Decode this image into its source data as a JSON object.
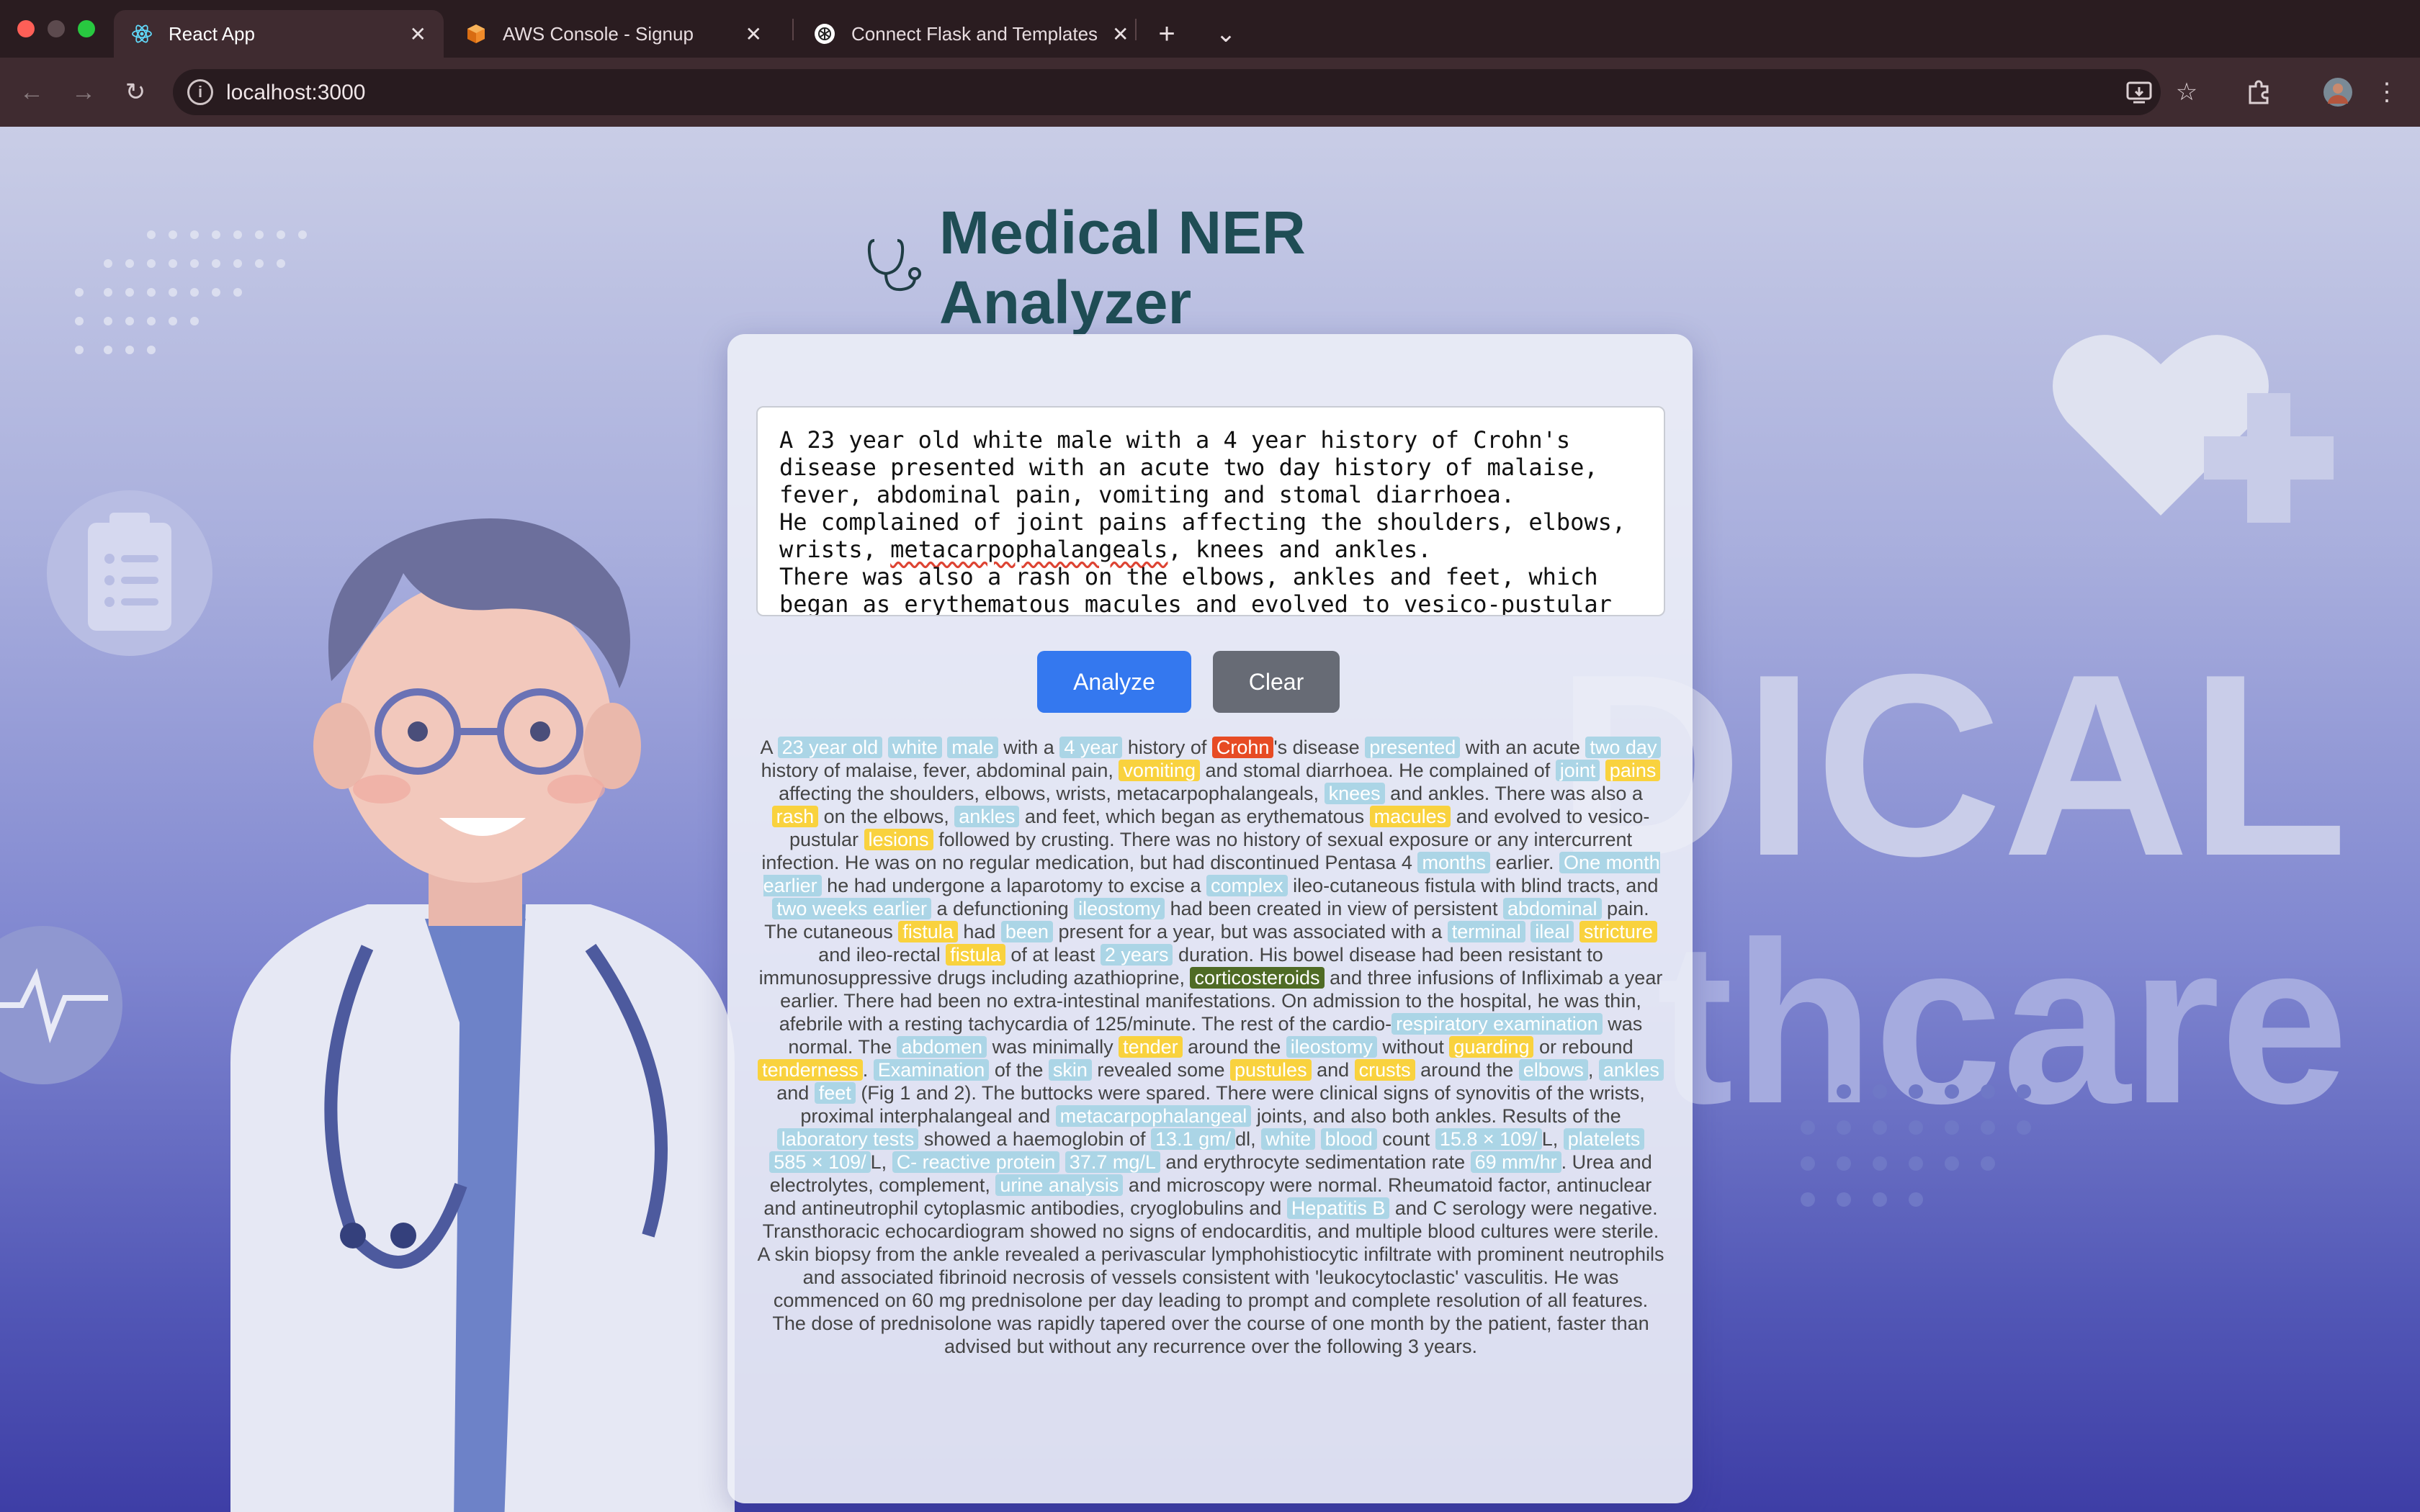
{
  "tabs": [
    {
      "label": "React App",
      "close": "✕"
    },
    {
      "label": "AWS Console - Signup",
      "close": "✕"
    },
    {
      "label": "Connect Flask and Templates",
      "close": "✕"
    }
  ],
  "new_tab_label": "+",
  "tab_list_label": "⌄",
  "address": "localhost:3000",
  "app": {
    "title": "Medical NER Analyzer",
    "textarea_text": "A 23 year old white male with a 4 year history of Crohn's disease presented with an acute two day history of malaise, fever, abdominal pain, vomiting and stomal diarrhoea.\nHe complained of joint pains affecting the shoulders, elbows, wrists, metacarpophalangeals, knees and ankles.\nThere was also a rash on the elbows, ankles and feet, which began as erythematous macules and evolved to vesico-pustular",
    "analyze_label": "Analyze",
    "clear_label": "Clear",
    "background_words": [
      "DICAL",
      "thcare"
    ],
    "entity_colors": {
      "b": "#abd5e6",
      "y": "#f9d23e",
      "r": "#e74b24",
      "g": "#4f6b25"
    },
    "result": [
      [
        "A ",
        ""
      ],
      [
        "23 year old",
        "b"
      ],
      [
        " ",
        ""
      ],
      [
        "white",
        "b"
      ],
      [
        " ",
        ""
      ],
      [
        "male",
        "b"
      ],
      [
        " with a ",
        ""
      ],
      [
        "4 year",
        "b"
      ],
      [
        " history of ",
        ""
      ],
      [
        "Crohn",
        "r"
      ],
      [
        "'s disease ",
        ""
      ],
      [
        "presented",
        "b"
      ],
      [
        " with an acute ",
        ""
      ],
      [
        "two day",
        "b"
      ],
      [
        " history of malaise, fever, abdominal pain, ",
        ""
      ],
      [
        "vomiting",
        "y"
      ],
      [
        " and stomal diarrhoea. He complained of ",
        ""
      ],
      [
        "joint",
        "b"
      ],
      [
        " ",
        ""
      ],
      [
        "pains",
        "y"
      ],
      [
        " affecting the shoulders, elbows, wrists, metacarpophalangeals, ",
        ""
      ],
      [
        "knees",
        "b"
      ],
      [
        " and ankles. There was also a ",
        ""
      ],
      [
        "rash",
        "y"
      ],
      [
        " on the elbows, ",
        ""
      ],
      [
        "ankles",
        "b"
      ],
      [
        " and feet, which began as erythematous ",
        ""
      ],
      [
        "macules",
        "y"
      ],
      [
        " and evolved to vesico-pustular ",
        ""
      ],
      [
        "lesions",
        "y"
      ],
      [
        " followed by crusting. There was no history of sexual exposure or any intercurrent infection. He was on no regular medication, but had discontinued Pentasa 4 ",
        ""
      ],
      [
        "months",
        "b"
      ],
      [
        " earlier. ",
        ""
      ],
      [
        "One month earlier",
        "b"
      ],
      [
        " he had undergone a laparotomy to excise a ",
        ""
      ],
      [
        "complex",
        "b"
      ],
      [
        " ileo-cutaneous fistula with blind tracts, and ",
        ""
      ],
      [
        "two weeks earlier",
        "b"
      ],
      [
        " a defunctioning ",
        ""
      ],
      [
        "ileostomy",
        "b"
      ],
      [
        " had been created in view of persistent ",
        ""
      ],
      [
        "abdominal",
        "b"
      ],
      [
        " pain. The cutaneous ",
        ""
      ],
      [
        "fistula",
        "y"
      ],
      [
        " had ",
        ""
      ],
      [
        "been",
        "b"
      ],
      [
        " present for a year, but was associated with a ",
        ""
      ],
      [
        "terminal",
        "b"
      ],
      [
        " ",
        ""
      ],
      [
        "ileal",
        "b"
      ],
      [
        " ",
        ""
      ],
      [
        "stricture",
        "y"
      ],
      [
        " and ileo-rectal ",
        ""
      ],
      [
        "fistula",
        "y"
      ],
      [
        " of at least ",
        ""
      ],
      [
        "2 years",
        "b"
      ],
      [
        " duration. His bowel disease had been resistant to immunosuppressive drugs including azathioprine, ",
        ""
      ],
      [
        "corticosteroids",
        "g"
      ],
      [
        " and three infusions of Infliximab a year earlier. There had been no extra-intestinal manifestations. On admission to the hospital, he was thin, afebrile with a resting tachycardia of 125/minute. The rest of the cardio-",
        ""
      ],
      [
        "respiratory examination",
        "b"
      ],
      [
        " was normal. The ",
        ""
      ],
      [
        "abdomen",
        "b"
      ],
      [
        " was minimally ",
        ""
      ],
      [
        "tender",
        "y"
      ],
      [
        " around the ",
        ""
      ],
      [
        "ileostomy",
        "b"
      ],
      [
        " without ",
        ""
      ],
      [
        "guarding",
        "y"
      ],
      [
        " or rebound ",
        ""
      ],
      [
        "tenderness",
        "y"
      ],
      [
        ". ",
        ""
      ],
      [
        "Examination",
        "b"
      ],
      [
        " of the ",
        ""
      ],
      [
        "skin",
        "b"
      ],
      [
        " revealed some ",
        ""
      ],
      [
        "pustules",
        "y"
      ],
      [
        " and ",
        ""
      ],
      [
        "crusts",
        "y"
      ],
      [
        " around the ",
        ""
      ],
      [
        "elbows",
        "b"
      ],
      [
        ", ",
        ""
      ],
      [
        "ankles",
        "b"
      ],
      [
        " and ",
        ""
      ],
      [
        "feet",
        "b"
      ],
      [
        " (Fig 1 and 2). The buttocks were spared. There were clinical signs of synovitis of the wrists, proximal interphalangeal and ",
        ""
      ],
      [
        "metacarpophalangeal",
        "b"
      ],
      [
        " joints, and also both ankles. Results of the ",
        ""
      ],
      [
        "laboratory tests",
        "b"
      ],
      [
        " showed a haemoglobin of ",
        ""
      ],
      [
        "13.1 gm/",
        "b"
      ],
      [
        "dl, ",
        ""
      ],
      [
        "white",
        "b"
      ],
      [
        " ",
        ""
      ],
      [
        "blood",
        "b"
      ],
      [
        " count ",
        ""
      ],
      [
        "15.8 × 109/",
        "b"
      ],
      [
        "L, ",
        ""
      ],
      [
        "platelets",
        "b"
      ],
      [
        " ",
        ""
      ],
      [
        "585 × 109/",
        "b"
      ],
      [
        "L, ",
        ""
      ],
      [
        "C- reactive protein",
        "b"
      ],
      [
        " ",
        ""
      ],
      [
        "37.7 mg/L",
        "b"
      ],
      [
        " and erythrocyte sedimentation rate ",
        ""
      ],
      [
        "69 mm/hr",
        "b"
      ],
      [
        ". Urea and electrolytes, complement, ",
        ""
      ],
      [
        "urine analysis",
        "b"
      ],
      [
        " and microscopy were normal. Rheumatoid factor, antinuclear and antineutrophil cytoplasmic antibodies, cryoglobulins and ",
        ""
      ],
      [
        "Hepatitis B",
        "b"
      ],
      [
        " and C serology were negative. Transthoracic echocardiogram showed no signs of endocarditis, and multiple blood cultures were sterile. A skin biopsy from the ankle revealed a perivascular lymphohistiocytic infiltrate with prominent neutrophils and associated fibrinoid necrosis of vessels consistent with 'leukocytoclastic' vasculitis. He was commenced on 60 mg prednisolone per day leading to prompt and complete resolution of all features. The dose of prednisolone was rapidly tapered over the course of one month by the patient, faster than advised but without any recurrence over the following 3 years.",
        ""
      ]
    ]
  }
}
